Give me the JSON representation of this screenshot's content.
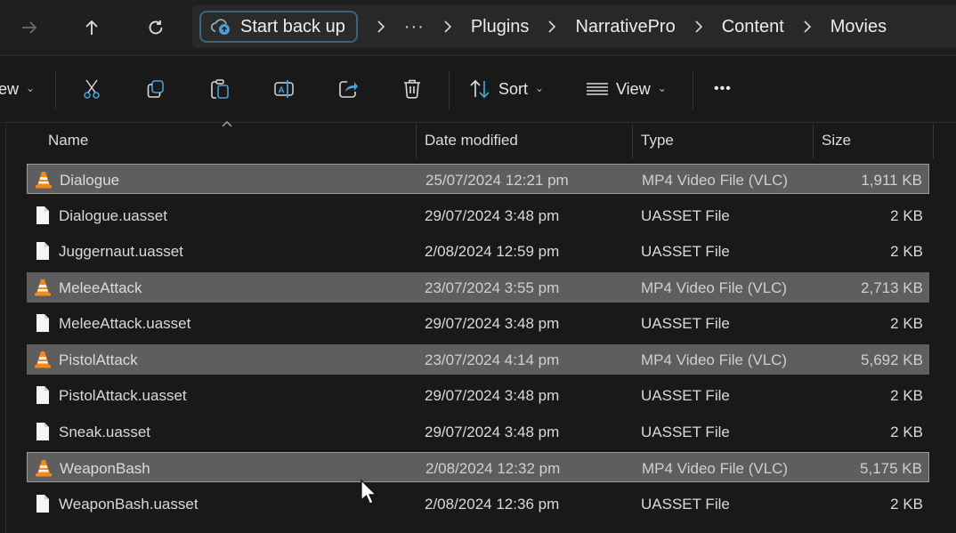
{
  "address_bar": {
    "back_icon": "arrow-right-icon",
    "up_icon": "arrow-up-icon",
    "refresh_icon": "refresh-icon",
    "backup_button": {
      "label": "Start back up",
      "icon": "cloud-backup-icon",
      "accent": "#3e6478"
    },
    "overflow_label": "···",
    "breadcrumbs": [
      "Plugins",
      "NarrativePro",
      "Content",
      "Movies"
    ]
  },
  "toolbar": {
    "new_label": "ew",
    "cut_icon": "scissors-icon",
    "copy_icon": "copy-icon",
    "paste_icon": "paste-icon",
    "rename_icon": "rename-icon",
    "share_icon": "share-icon",
    "delete_icon": "trash-icon",
    "sort_label": "Sort",
    "view_label": "View",
    "more_label": "•••"
  },
  "columns": {
    "name": "Name",
    "date": "Date modified",
    "type": "Type",
    "size": "Size"
  },
  "files": [
    {
      "name": "Dialogue",
      "date": "25/07/2024 12:21 pm",
      "type": "MP4 Video File (VLC)",
      "size": "1,911 KB",
      "icon": "vlc-cone-icon",
      "selected": true,
      "focused": true
    },
    {
      "name": "Dialogue.uasset",
      "date": "29/07/2024 3:48 pm",
      "type": "UASSET File",
      "size": "2 KB",
      "icon": "file-icon",
      "selected": false,
      "focused": false
    },
    {
      "name": "Juggernaut.uasset",
      "date": "2/08/2024 12:59 pm",
      "type": "UASSET File",
      "size": "2 KB",
      "icon": "file-icon",
      "selected": false,
      "focused": false
    },
    {
      "name": "MeleeAttack",
      "date": "23/07/2024 3:55 pm",
      "type": "MP4 Video File (VLC)",
      "size": "2,713 KB",
      "icon": "vlc-cone-icon",
      "selected": true,
      "focused": false
    },
    {
      "name": "MeleeAttack.uasset",
      "date": "29/07/2024 3:48 pm",
      "type": "UASSET File",
      "size": "2 KB",
      "icon": "file-icon",
      "selected": false,
      "focused": false
    },
    {
      "name": "PistolAttack",
      "date": "23/07/2024 4:14 pm",
      "type": "MP4 Video File (VLC)",
      "size": "5,692 KB",
      "icon": "vlc-cone-icon",
      "selected": true,
      "focused": false
    },
    {
      "name": "PistolAttack.uasset",
      "date": "29/07/2024 3:48 pm",
      "type": "UASSET File",
      "size": "2 KB",
      "icon": "file-icon",
      "selected": false,
      "focused": false
    },
    {
      "name": "Sneak.uasset",
      "date": "29/07/2024 3:48 pm",
      "type": "UASSET File",
      "size": "2 KB",
      "icon": "file-icon",
      "selected": false,
      "focused": false
    },
    {
      "name": "WeaponBash",
      "date": "2/08/2024 12:32 pm",
      "type": "MP4 Video File (VLC)",
      "size": "5,175 KB",
      "icon": "vlc-cone-icon",
      "selected": true,
      "focused": true
    },
    {
      "name": "WeaponBash.uasset",
      "date": "2/08/2024 12:36 pm",
      "type": "UASSET File",
      "size": "2 KB",
      "icon": "file-icon",
      "selected": false,
      "focused": false
    }
  ],
  "colors": {
    "background": "#191919",
    "selection": "#5e5e5e",
    "accent_blue": "#4a9fd4",
    "vlc_orange": "#f08a1c"
  }
}
